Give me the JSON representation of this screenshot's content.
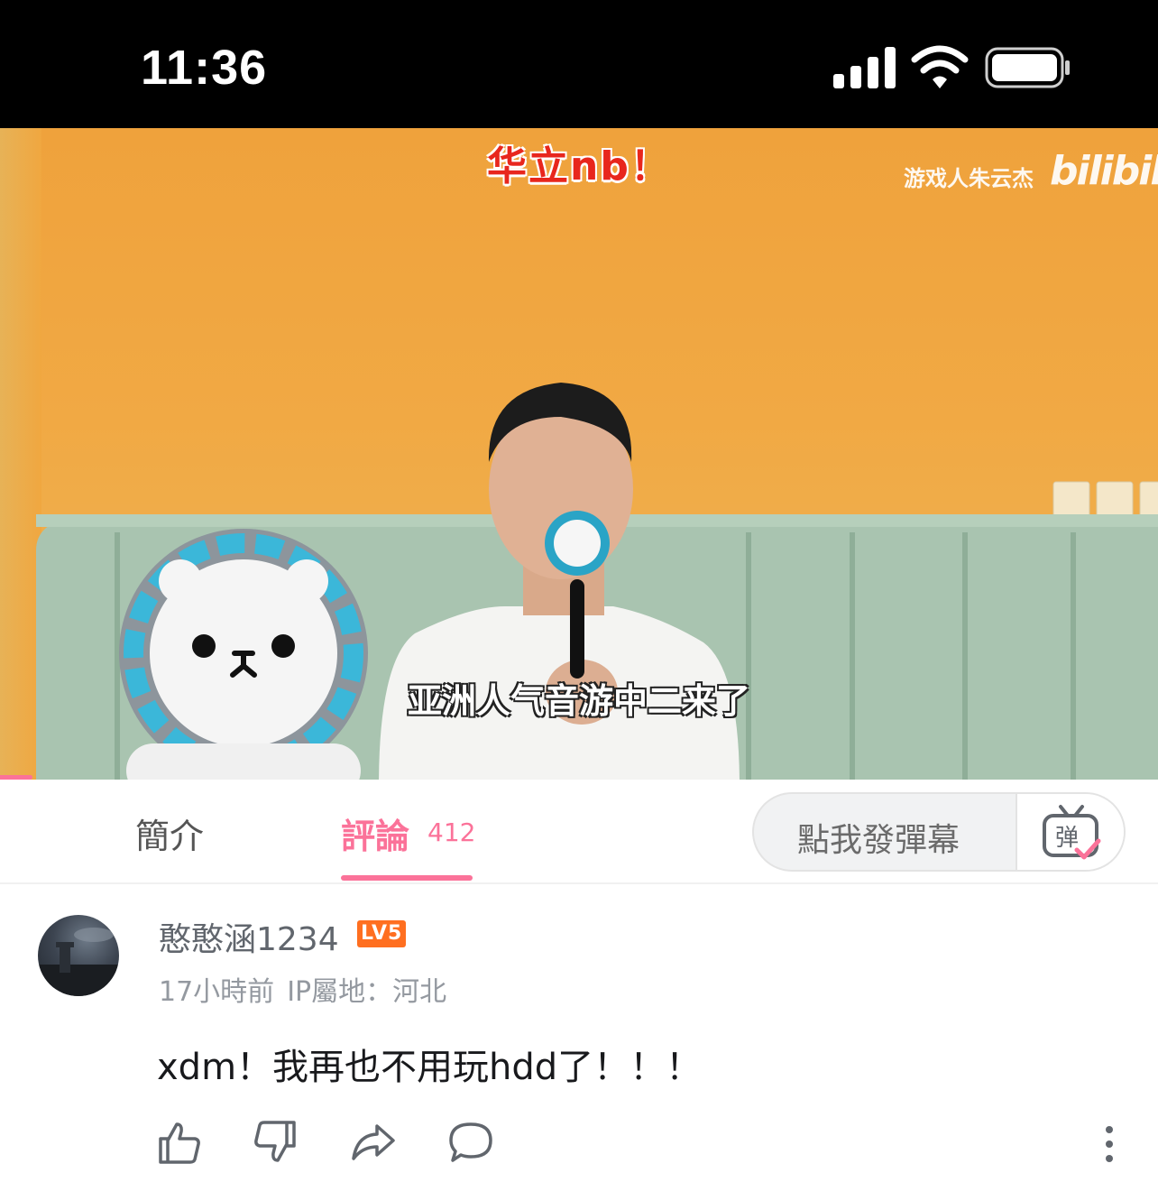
{
  "status_bar": {
    "time": "11:36"
  },
  "video": {
    "top_caption": "华立nb！",
    "watermark_author": "游戏人朱云杰",
    "watermark_logo": "bilibili",
    "subtitle": "亚洲人气音游中二来了",
    "progress_fraction": 0.03,
    "accent_color": "#fb7299"
  },
  "tabs": {
    "intro_label": "簡介",
    "comments_label": "評論",
    "comments_count": "412",
    "active": "comments"
  },
  "danmaku": {
    "placeholder": "點我發彈幕",
    "button_glyph": "弹"
  },
  "comment": {
    "username": "憨憨涵1234",
    "level": "LV5",
    "time_ago": "17小時前",
    "ip_location": "IP屬地：河北",
    "text": "xdm！我再也不用玩hdd了！！！",
    "actions": [
      "like-icon",
      "dislike-icon",
      "share-icon",
      "reply-icon",
      "more-icon"
    ]
  }
}
